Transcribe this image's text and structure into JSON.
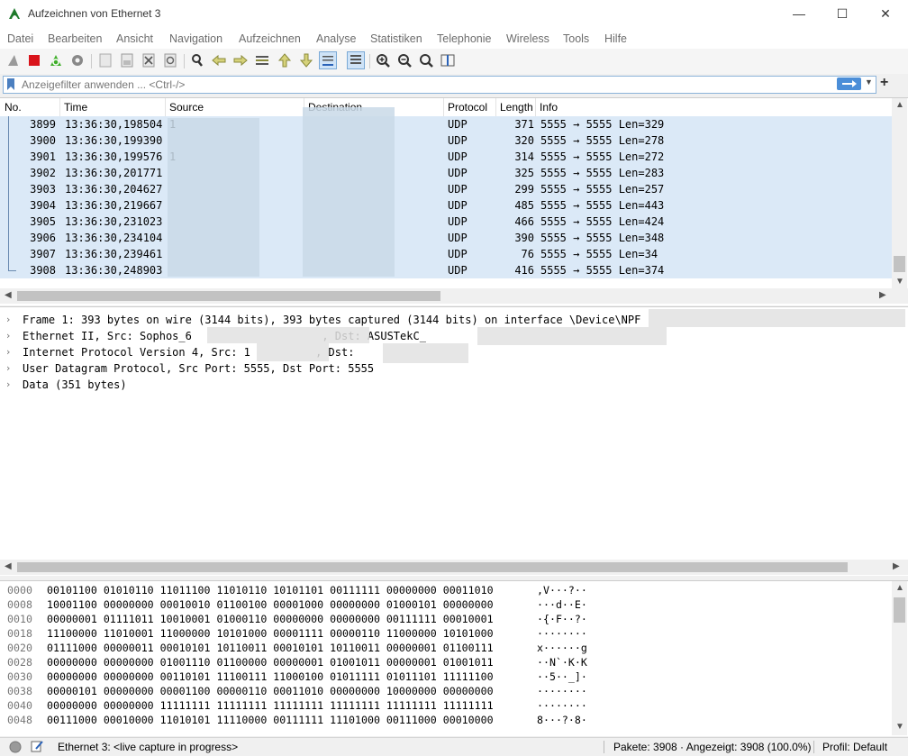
{
  "window": {
    "title": "Aufzeichnen von Ethernet 3",
    "minimize": "—",
    "maximize": "☐",
    "close": "✕"
  },
  "menu": [
    "Datei",
    "Bearbeiten",
    "Ansicht",
    "Navigation",
    "Aufzeichnen",
    "Analyse",
    "Statistiken",
    "Telephonie",
    "Wireless",
    "Tools",
    "Hilfe"
  ],
  "toolbar": [
    "shark-fin-icon",
    "stop-icon",
    "restart-icon",
    "options-gear-icon",
    "open-file-icon",
    "save-file-icon",
    "close-file-icon",
    "reload-icon",
    "find-icon",
    "back-icon",
    "forward-icon",
    "go-to-packet-icon",
    "first-packet-icon",
    "last-packet-icon",
    "autoscroll-icon",
    "colorize-icon",
    "zoom-in-icon",
    "zoom-out-icon",
    "zoom-normal-icon",
    "resize-columns-icon"
  ],
  "filter": {
    "placeholder": "Anzeigefilter anwenden ... <Ctrl-/>",
    "add": "+"
  },
  "packet_list": {
    "columns": [
      "No.",
      "Time",
      "Source",
      "Destination",
      "Protocol",
      "Length",
      "Info"
    ],
    "rows": [
      {
        "no": "3899",
        "time": "13:36:30,198504",
        "src": "1",
        "proto": "UDP",
        "len": "371",
        "info": "5555 → 5555 Len=329"
      },
      {
        "no": "3900",
        "time": "13:36:30,199390",
        "src": "",
        "proto": "UDP",
        "len": "320",
        "info": "5555 → 5555 Len=278"
      },
      {
        "no": "3901",
        "time": "13:36:30,199576",
        "src": "1",
        "proto": "UDP",
        "len": "314",
        "info": "5555 → 5555 Len=272"
      },
      {
        "no": "3902",
        "time": "13:36:30,201771",
        "src": "",
        "proto": "UDP",
        "len": "325",
        "info": "5555 → 5555 Len=283"
      },
      {
        "no": "3903",
        "time": "13:36:30,204627",
        "src": "",
        "proto": "UDP",
        "len": "299",
        "info": "5555 → 5555 Len=257"
      },
      {
        "no": "3904",
        "time": "13:36:30,219667",
        "src": "",
        "proto": "UDP",
        "len": "485",
        "info": "5555 → 5555 Len=443"
      },
      {
        "no": "3905",
        "time": "13:36:30,231023",
        "src": "",
        "proto": "UDP",
        "len": "466",
        "info": "5555 → 5555 Len=424"
      },
      {
        "no": "3906",
        "time": "13:36:30,234104",
        "src": "",
        "proto": "UDP",
        "len": "390",
        "info": "5555 → 5555 Len=348"
      },
      {
        "no": "3907",
        "time": "13:36:30,239461",
        "src": "",
        "proto": "UDP",
        "len": "76",
        "info": "5555 → 5555 Len=34"
      },
      {
        "no": "3908",
        "time": "13:36:30,248903",
        "src": "",
        "proto": "UDP",
        "len": "416",
        "info": "5555 → 5555 Len=374"
      }
    ]
  },
  "details": [
    "Frame 1: 393 bytes on wire (3144 bits), 393 bytes captured (3144 bits) on interface \\Device\\NPF",
    "Ethernet II, Src: Sophos_6                    , Dst: ASUSTekC_",
    "Internet Protocol Version 4, Src: 1          , Dst: ",
    "User Datagram Protocol, Src Port: 5555, Dst Port: 5555",
    "Data (351 bytes)"
  ],
  "bytes": [
    {
      "off": "0000",
      "hex": "00101100 01010110 11011100 11010110 10101101 00111111 00000000 00011010",
      "ascii": ",V···?··"
    },
    {
      "off": "0008",
      "hex": "10001100 00000000 00010010 01100100 00001000 00000000 01000101 00000000",
      "ascii": "···d··E·"
    },
    {
      "off": "0010",
      "hex": "00000001 01111011 10010001 01000110 00000000 00000000 00111111 00010001",
      "ascii": "·{·F··?·"
    },
    {
      "off": "0018",
      "hex": "11100000 11010001 11000000 10101000 00001111 00000110 11000000 10101000",
      "ascii": "········"
    },
    {
      "off": "0020",
      "hex": "01111000 00000011 00010101 10110011 00010101 10110011 00000001 01100111",
      "ascii": "x······g"
    },
    {
      "off": "0028",
      "hex": "00000000 00000000 01001110 01100000 00000001 01001011 00000001 01001011",
      "ascii": "··N`·K·K"
    },
    {
      "off": "0030",
      "hex": "00000000 00000000 00110101 11100111 11000100 01011111 01011101 11111100",
      "ascii": "··5··_]·"
    },
    {
      "off": "0038",
      "hex": "00000101 00000000 00001100 00000110 00011010 00000000 10000000 00000000",
      "ascii": "········"
    },
    {
      "off": "0040",
      "hex": "00000000 00000000 11111111 11111111 11111111 11111111 11111111 11111111",
      "ascii": "········"
    },
    {
      "off": "0048",
      "hex": "00111000 00010000 11010101 11110000 00111111 11101000 00111000 00010000",
      "ascii": "8···?·8·"
    }
  ],
  "status": {
    "interface": "Ethernet 3: <live capture in progress>",
    "packets": "Pakete: 3908 · Angezeigt: 3908 (100.0%)",
    "profile": "Profil: Default"
  },
  "colors": {
    "selected_row": "#dbe9f7",
    "apply_button": "#4b8ed8",
    "stop": "#d9141b",
    "restart": "#3fae2a"
  }
}
